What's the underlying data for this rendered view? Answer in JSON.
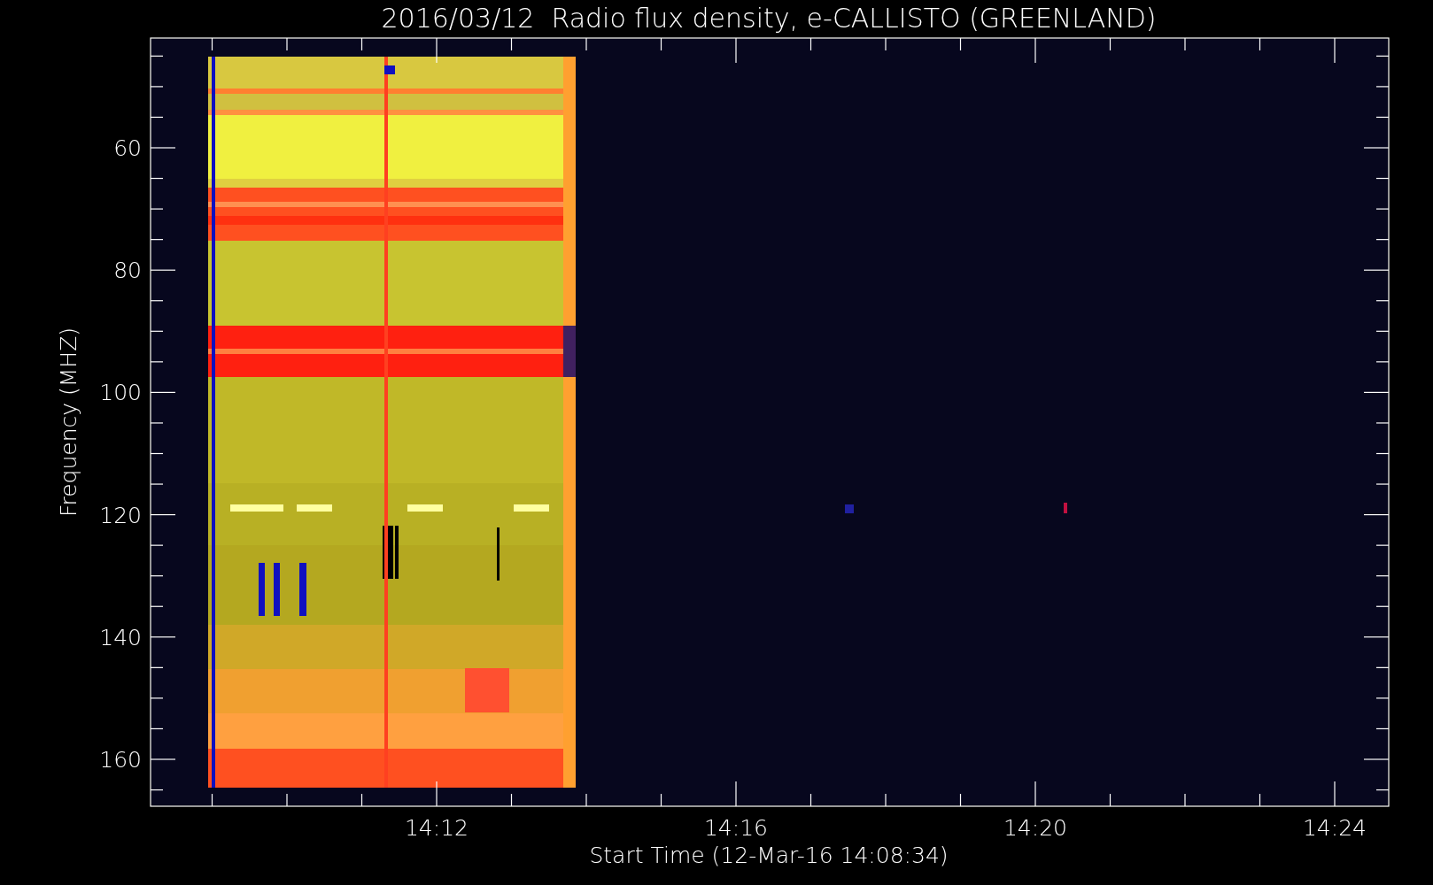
{
  "title": "2016/03/12  Radio flux density, e-CALLISTO (GREENLAND)",
  "y_axis": {
    "label": "Frequency (MHZ)",
    "ticks": [
      "60",
      "80",
      "100",
      "120",
      "140",
      "160"
    ]
  },
  "x_axis": {
    "label": "Start Time (12-Mar-16 14:08:34)",
    "ticks": [
      "14:12",
      "14:16",
      "14:20",
      "14:24"
    ]
  }
}
